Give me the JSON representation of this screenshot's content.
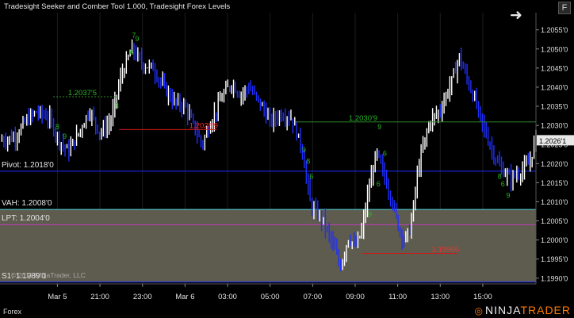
{
  "title": "Tradesight Seeker and Comber Tool 1.000, Tradesight Forex Levels",
  "buttons": {
    "panel_toggle": "F"
  },
  "instrument_label": "Forex",
  "copyright": "© 2012 NinjaTrader, LLC",
  "brand": {
    "prefix": "NINJA",
    "suffix": "TRADER"
  },
  "colors": {
    "background": "#000000",
    "up_bar": "#ffffff",
    "down_bar": "#1f2fff",
    "pivot_line": "#1a2cff",
    "vah_line": "#4fd6e0",
    "lpt_line": "#c03ac0",
    "value_area_fill": "#5e5c4e",
    "resistance_line": "#2e8a2e",
    "support_line": "#d01818",
    "seeker_text": "#27b427",
    "brand_accent": "#ff7a00"
  },
  "levels": [
    {
      "name": "pivot",
      "label": "Pivot: 1.2018'0",
      "price": 1.2018
    },
    {
      "name": "vah",
      "label": "VAH: 1.2008'0",
      "price": 1.2008
    },
    {
      "name": "lpt",
      "label": "LPT: 1.2004'0",
      "price": 1.2004
    },
    {
      "name": "s1",
      "label": "S1: 1.1989'0",
      "price": 1.1989
    }
  ],
  "annotations": [
    {
      "text": "1.2037'5",
      "price": 1.20375,
      "color": "green"
    },
    {
      "text": "1.2028'9",
      "price": 1.20289,
      "color": "red"
    },
    {
      "text": "1.2030'9",
      "price": 1.20309,
      "color": "green"
    },
    {
      "text": "1.19965",
      "price": 1.19965,
      "color": "red"
    }
  ],
  "last_price_label": "1.2026'1",
  "chart_data": {
    "type": "bar",
    "ylim": [
      1.19885,
      1.20595
    ],
    "y_ticks": [
      "1.2055'0",
      "1.2050'0",
      "1.2045'0",
      "1.2040'0",
      "1.2035'0",
      "1.2030'0",
      "1.2025'0",
      "1.2020'0",
      "1.2015'0",
      "1.2010'0",
      "1.2005'0",
      "1.2000'0",
      "1.1995'0",
      "1.1990'0"
    ],
    "y_tick_values": [
      1.2055,
      1.205,
      1.2045,
      1.204,
      1.2035,
      1.203,
      1.2025,
      1.202,
      1.2015,
      1.201,
      1.2005,
      1.2,
      1.1995,
      1.199
    ],
    "x_ticks": [
      "Mar 5",
      "21:00",
      "23:00",
      "Mar 6",
      "03:00",
      "05:00",
      "07:00",
      "09:00",
      "11:00",
      "13:00",
      "15:00"
    ],
    "x_tick_hours": [
      1,
      3,
      5,
      7,
      9,
      11,
      13,
      15,
      17,
      19,
      21
    ],
    "x_range_hours": [
      -1.7,
      23.5
    ],
    "waypoints": [
      [
        -1.7,
        1.2026
      ],
      [
        -1.0,
        1.2027
      ],
      [
        -0.5,
        1.2031
      ],
      [
        0.0,
        1.20335
      ],
      [
        0.6,
        1.2032
      ],
      [
        1.0,
        1.2027
      ],
      [
        1.5,
        1.2023
      ],
      [
        2.0,
        1.2028
      ],
      [
        2.5,
        1.2034
      ],
      [
        3.0,
        1.2028
      ],
      [
        3.5,
        1.2031
      ],
      [
        4.0,
        1.2043
      ],
      [
        4.5,
        1.205
      ],
      [
        5.0,
        1.2046
      ],
      [
        5.5,
        1.2045
      ],
      [
        6.0,
        1.204
      ],
      [
        6.5,
        1.2036
      ],
      [
        7.0,
        1.2035
      ],
      [
        7.4,
        1.203
      ],
      [
        7.8,
        1.2025
      ],
      [
        8.3,
        1.2032
      ],
      [
        8.8,
        1.2038
      ],
      [
        9.2,
        1.2041
      ],
      [
        9.6,
        1.2038
      ],
      [
        10.0,
        1.204
      ],
      [
        10.5,
        1.2036
      ],
      [
        11.0,
        1.2031
      ],
      [
        11.5,
        1.2033
      ],
      [
        12.0,
        1.2032
      ],
      [
        12.5,
        1.2024
      ],
      [
        12.9,
        1.2009
      ],
      [
        13.5,
        1.2005
      ],
      [
        14.0,
        1.1998
      ],
      [
        14.3,
        1.1993
      ],
      [
        14.7,
        1.2001
      ],
      [
        15.0,
        1.1998
      ],
      [
        15.3,
        1.2002
      ],
      [
        15.6,
        1.2012
      ],
      [
        16.0,
        1.2023
      ],
      [
        16.3,
        1.2018
      ],
      [
        16.7,
        1.2011
      ],
      [
        17.0,
        1.2004
      ],
      [
        17.3,
        1.2
      ],
      [
        17.6,
        1.2003
      ],
      [
        18.0,
        1.202
      ],
      [
        18.5,
        1.2031
      ],
      [
        19.0,
        1.2034
      ],
      [
        19.5,
        1.2041
      ],
      [
        19.9,
        1.2048
      ],
      [
        20.2,
        1.2043
      ],
      [
        20.6,
        1.2037
      ],
      [
        21.0,
        1.203
      ],
      [
        21.4,
        1.2024
      ],
      [
        21.8,
        1.2019
      ],
      [
        22.3,
        1.2016
      ],
      [
        22.8,
        1.2018
      ],
      [
        23.2,
        1.202
      ],
      [
        23.5,
        1.2027
      ]
    ],
    "seeker_labels": [
      {
        "text": "7",
        "hour": 4.5,
        "price": 1.2053
      },
      {
        "text": "9",
        "hour": 4.65,
        "price": 1.2052
      },
      {
        "text": "6",
        "hour": 4.4,
        "price": 1.20485
      },
      {
        "text": "8",
        "hour": 0.9,
        "price": 1.2029
      },
      {
        "text": "9",
        "hour": 1.25,
        "price": 1.20265
      },
      {
        "text": "8",
        "hour": 3.7,
        "price": 1.20345
      },
      {
        "text": "9",
        "hour": 12.5,
        "price": 1.2023
      },
      {
        "text": "8",
        "hour": 12.7,
        "price": 1.202
      },
      {
        "text": "6",
        "hour": 12.85,
        "price": 1.2016
      },
      {
        "text": "6",
        "hour": 16.3,
        "price": 1.2022
      },
      {
        "text": "9",
        "hour": 15.6,
        "price": 1.2006
      },
      {
        "text": "6",
        "hour": 16.0,
        "price": 1.2014
      },
      {
        "text": "8",
        "hour": 21.7,
        "price": 1.2016
      },
      {
        "text": "6",
        "hour": 21.85,
        "price": 1.2014
      },
      {
        "text": "9",
        "hour": 22.1,
        "price": 1.2011
      },
      {
        "text": "9",
        "hour": 16.05,
        "price": 1.2029
      }
    ]
  }
}
